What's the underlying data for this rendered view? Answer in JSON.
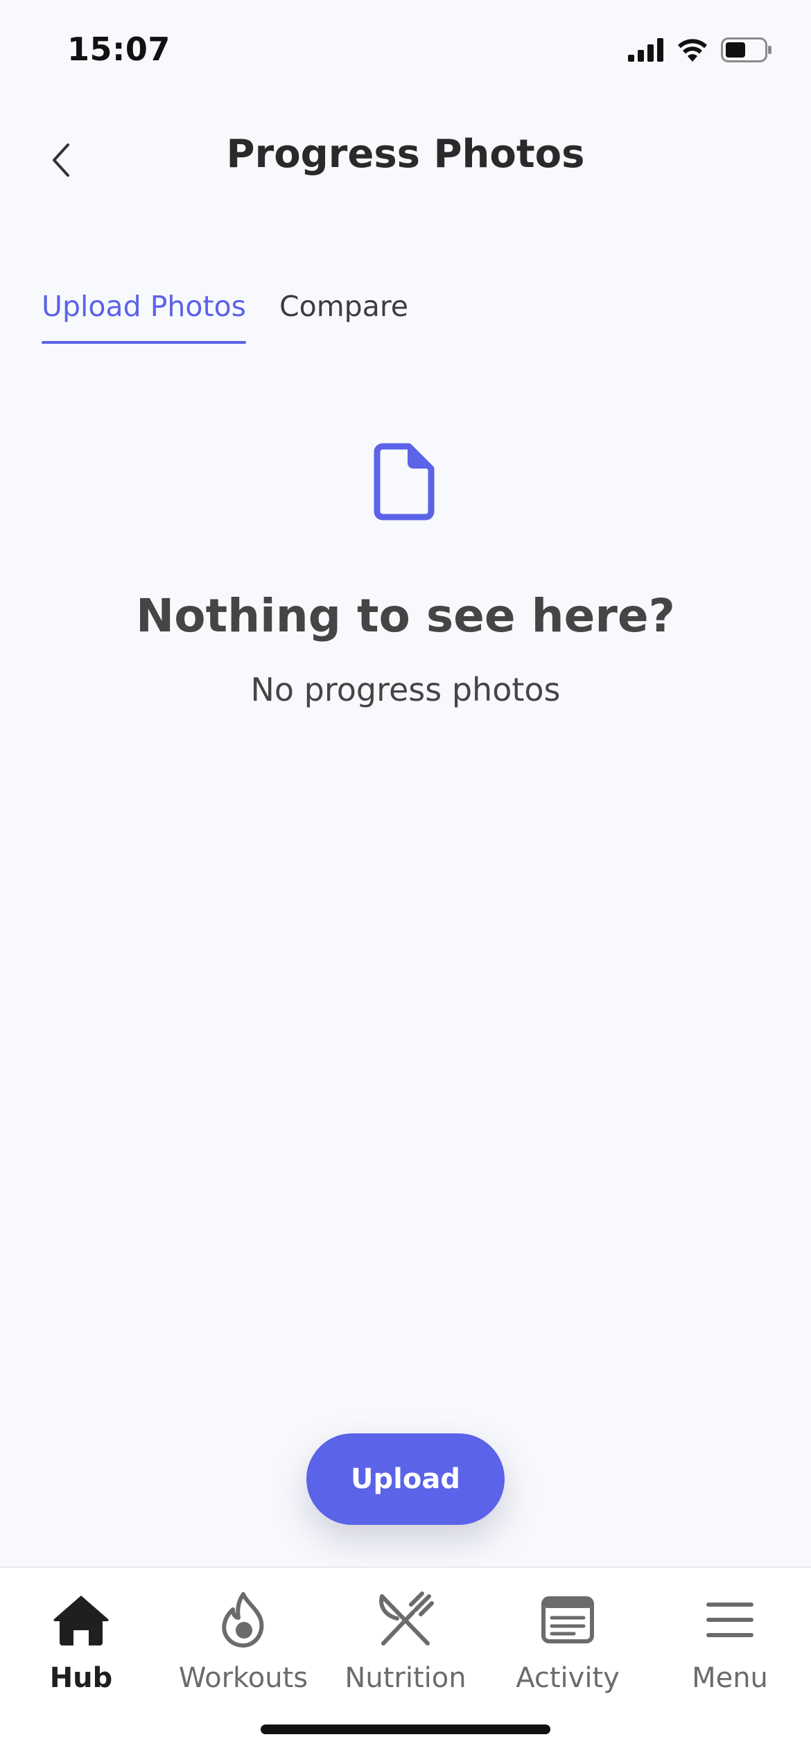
{
  "status_bar": {
    "time": "15:07",
    "icons": [
      "signal-icon",
      "wifi-icon",
      "battery-icon"
    ]
  },
  "header": {
    "title": "Progress Photos",
    "back_icon": "chevron-left-icon"
  },
  "tabs": [
    {
      "label": "Upload Photos",
      "active": true
    },
    {
      "label": "Compare",
      "active": false
    }
  ],
  "empty_state": {
    "icon": "document-icon",
    "title": "Nothing to see here?",
    "subtitle": "No progress photos"
  },
  "upload_button": {
    "label": "Upload"
  },
  "tab_bar": {
    "items": [
      {
        "label": "Hub",
        "icon": "home-icon",
        "active": true
      },
      {
        "label": "Workouts",
        "icon": "flame-icon",
        "active": false
      },
      {
        "label": "Nutrition",
        "icon": "fork-knife-icon",
        "active": false
      },
      {
        "label": "Activity",
        "icon": "activity-card-icon",
        "active": false
      },
      {
        "label": "Menu",
        "icon": "hamburger-icon",
        "active": false
      }
    ]
  },
  "colors": {
    "accent": "#5b63e8",
    "background": "#f8f9fd",
    "text_primary": "#2a2a2a",
    "text_secondary": "#454545"
  }
}
